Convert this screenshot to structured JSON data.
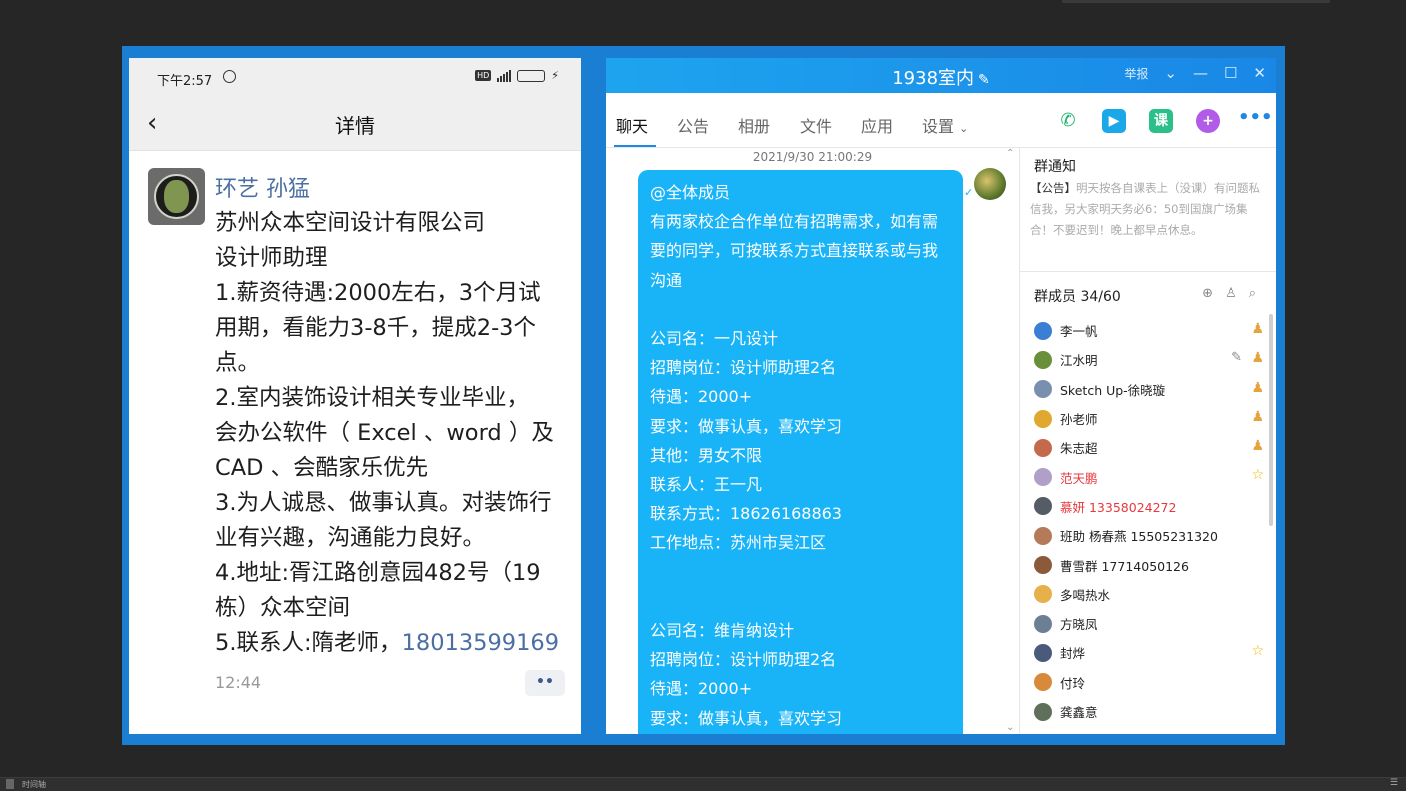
{
  "phone": {
    "status_time": "下午2:57",
    "nav_title": "详情",
    "sender": "环艺  孙猛",
    "lines": [
      "苏州众本空间设计有限公司",
      "设计师助理",
      "1.薪资待遇:2000左右，3个月试",
      "用期，看能力3-8千，提成2-3个",
      "点。",
      "2.室内装饰设计相关专业毕业，",
      "会办公软件（ Excel 、word ）及",
      "CAD 、会酷家乐优先",
      "3.为人诚恳、做事认真。对装饰行",
      "业有兴趣，沟通能力良好。",
      "4.地址:胥江路创意园482号（19",
      "栋）众本空间"
    ],
    "last_line_prefix": "5.联系人:隋老师，",
    "phone_number": "18013599169",
    "msg_time": "12:44",
    "more_label": "••"
  },
  "qq": {
    "group_name": "1938室内",
    "report_label": "举报",
    "tabs": [
      "聊天",
      "公告",
      "相册",
      "文件",
      "应用",
      "设置"
    ],
    "chat_timestamp": "2021/9/30 21:00:29",
    "message_lines": [
      "@全体成员",
      "有两家校企合作单位有招聘需求，如有需",
      "要的同学，可按联系方式直接联系或与我",
      "沟通",
      "",
      "公司名：一凡设计",
      "招聘岗位：设计师助理2名",
      "待遇：2000+",
      "要求：做事认真，喜欢学习",
      "其他：男女不限",
      "联系人：王一凡",
      "联系方式：18626168863",
      "工作地点：苏州市吴江区",
      "",
      "",
      "公司名：维肯纳设计",
      "招聘岗位：设计师助理2名",
      "待遇：2000+",
      "要求：做事认真，喜欢学习"
    ],
    "notice_title": "群通知",
    "notice_tag": "【公告】",
    "notice_text": "明天按各自课表上（没课）有问题私信我，另大家明天务必6：50到国旗广场集合！不要迟到！晚上都早点休息。",
    "members_title": "群成员 34/60",
    "members": [
      {
        "name": "李一帆",
        "red": false,
        "badge": "admin",
        "edit": false,
        "color": "#3b7fd4"
      },
      {
        "name": "江水明",
        "red": false,
        "badge": "admin",
        "edit": true,
        "color": "#6a8f3a"
      },
      {
        "name": "Sketch Up-徐晓璇",
        "red": false,
        "badge": "admin",
        "edit": false,
        "color": "#7a8fb0"
      },
      {
        "name": "孙老师",
        "red": false,
        "badge": "admin",
        "edit": false,
        "color": "#e0a830"
      },
      {
        "name": "朱志超",
        "red": false,
        "badge": "admin",
        "edit": false,
        "color": "#c46a4a"
      },
      {
        "name": "范天鹏",
        "red": true,
        "badge": "star",
        "edit": false,
        "color": "#b0a0c8"
      },
      {
        "name": "慕妍 13358024272",
        "red": true,
        "badge": "",
        "edit": false,
        "color": "#555c66"
      },
      {
        "name": "班助 杨春燕 15505231320",
        "red": false,
        "badge": "",
        "edit": false,
        "color": "#b57a5a"
      },
      {
        "name": "曹雪群 17714050126",
        "red": false,
        "badge": "",
        "edit": false,
        "color": "#8a5a3a"
      },
      {
        "name": "多喝热水",
        "red": false,
        "badge": "",
        "edit": false,
        "color": "#e8b04a"
      },
      {
        "name": "方晓凤",
        "red": false,
        "badge": "",
        "edit": false,
        "color": "#6d7f95"
      },
      {
        "name": "封烨",
        "red": false,
        "badge": "star",
        "edit": false,
        "color": "#4a5a7a"
      },
      {
        "name": "付玲",
        "red": false,
        "badge": "",
        "edit": false,
        "color": "#d88a3a"
      },
      {
        "name": "龚鑫意",
        "red": false,
        "badge": "",
        "edit": false,
        "color": "#5f6f5a"
      }
    ]
  },
  "footer": {
    "timeline_label": "时间轴"
  }
}
